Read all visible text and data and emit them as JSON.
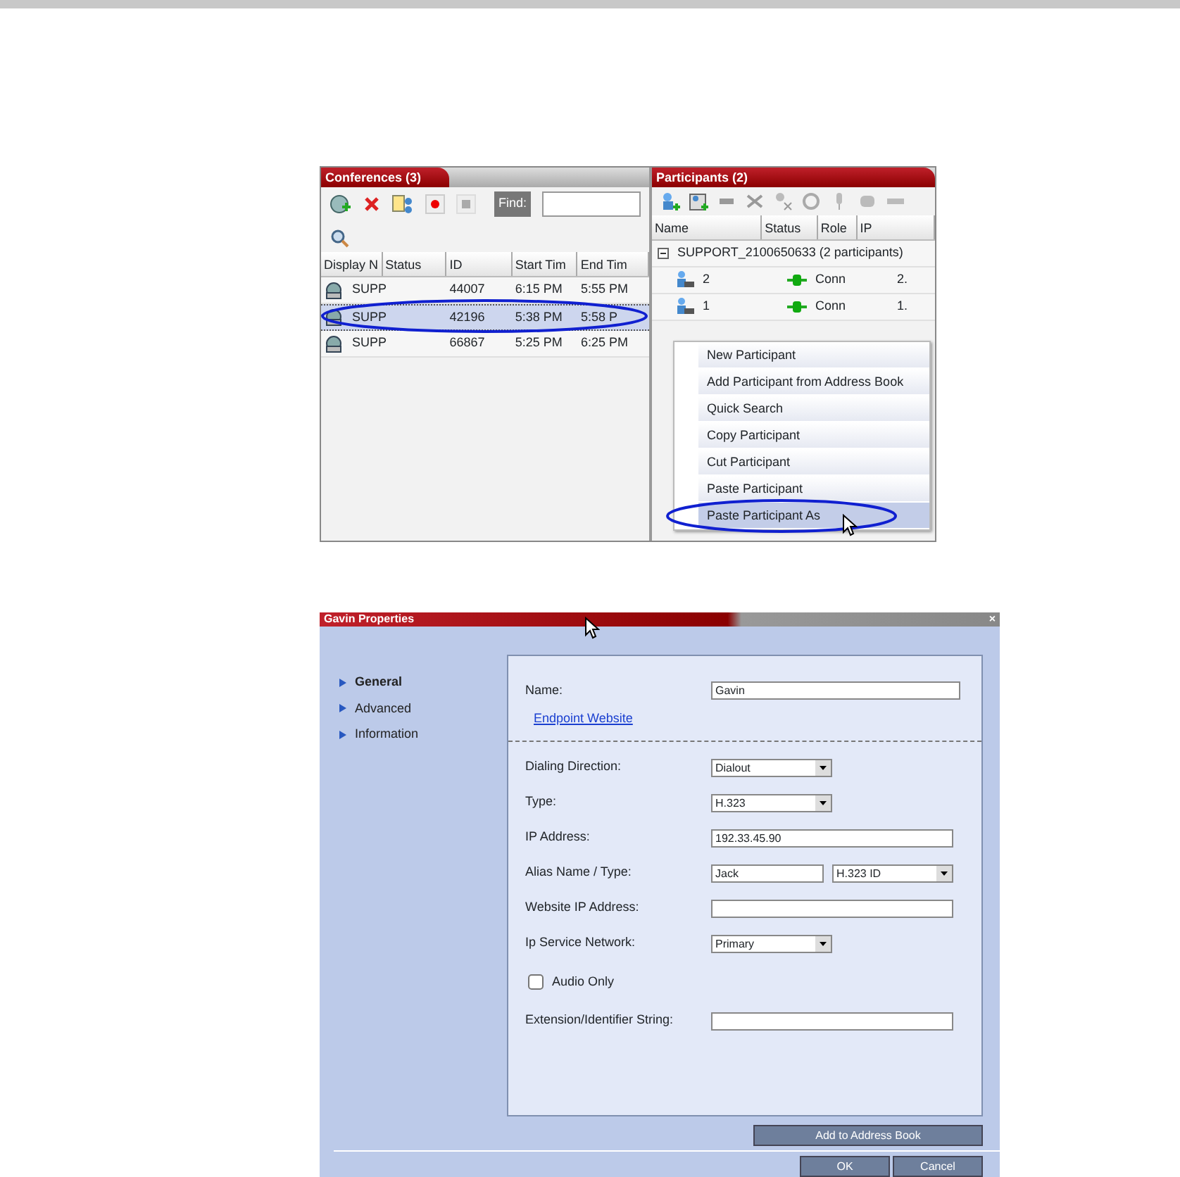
{
  "conferences": {
    "title": "Conferences (3)",
    "find_label": "Find:",
    "columns": [
      "Display N",
      "Status",
      "ID",
      "Start Tim",
      "End Tim"
    ],
    "rows": [
      {
        "name": "SUPP",
        "id": "44007",
        "start": "6:15 PM",
        "end": "5:55 PM",
        "selected": false
      },
      {
        "name": "SUPP",
        "id": "42196",
        "start": "5:38 PM",
        "end": "5:58 P",
        "selected": true
      },
      {
        "name": "SUPP",
        "id": "66867",
        "start": "5:25 PM",
        "end": "6:25 PM",
        "selected": false
      }
    ]
  },
  "participants": {
    "title": "Participants (2)",
    "columns": [
      "Name",
      "Status",
      "Role",
      "IP"
    ],
    "group": {
      "label": "SUPPORT_2100650633 (2 participants)",
      "expanded": true
    },
    "rows": [
      {
        "name": "2",
        "status": "Conn",
        "ip": "2."
      },
      {
        "name": "1",
        "status": "Conn",
        "ip": "1."
      }
    ]
  },
  "context_menu": [
    {
      "label": "New Participant",
      "selected": false
    },
    {
      "label": "Add Participant from Address Book",
      "selected": false
    },
    {
      "label": "Quick Search",
      "selected": false
    },
    {
      "label": "Copy Participant",
      "selected": false
    },
    {
      "label": "Cut Participant",
      "selected": false
    },
    {
      "label": "Paste Participant",
      "selected": false
    },
    {
      "label": "Paste Participant As",
      "selected": true
    }
  ],
  "dialog": {
    "title": "Gavin Properties",
    "close": "×",
    "nav": [
      {
        "label": "General",
        "selected": true
      },
      {
        "label": "Advanced",
        "selected": false
      },
      {
        "label": "Information",
        "selected": false
      }
    ],
    "name_label": "Name:",
    "name_value": "Gavin",
    "link": "Endpoint Website",
    "fields": [
      {
        "kind": "select",
        "label": "Dialing Direction:",
        "value": "Dialout"
      },
      {
        "kind": "select",
        "label": "Type:",
        "value": "H.323"
      },
      {
        "kind": "text",
        "label": "IP Address:",
        "value": "192.33.45.90"
      },
      {
        "kind": "pair",
        "label": "Alias Name / Type:",
        "value": "Jack",
        "type": "H.323 ID"
      },
      {
        "kind": "text",
        "label": "Website IP Address:"
      },
      {
        "kind": "select",
        "label": "Ip Service Network:",
        "value": "Primary"
      },
      {
        "kind": "checkbox",
        "label": "Audio Only",
        "checked": false
      },
      {
        "kind": "text",
        "label": "Extension/Identifier String:"
      }
    ],
    "address_book_button": "Add to Address Book",
    "buttons": [
      "OK",
      "Cancel"
    ]
  }
}
